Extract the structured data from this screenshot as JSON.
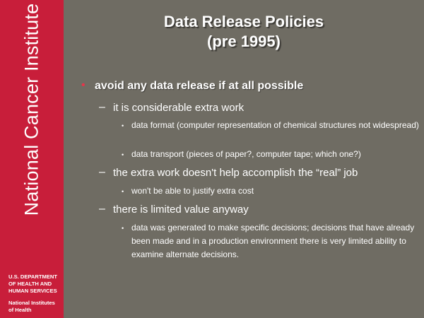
{
  "sidebar": {
    "title": "National Cancer Institute",
    "dept": [
      "U.S. DEPARTMENT",
      "OF HEALTH AND",
      "HUMAN SERVICES"
    ],
    "nih": [
      "National Institutes",
      "of Health"
    ],
    "color": "#c81e3a"
  },
  "slide": {
    "title_line1": "Data Release Policies",
    "title_line2": "(pre 1995)",
    "background": "#6f6c63"
  },
  "bullets": {
    "main": "avoid any data release if at all possible",
    "sub1": {
      "text": "it is considerable extra work",
      "items": [
        "data format (computer representation of chemical structures not widespread)",
        "data transport (pieces of paper?, computer tape; which one?)"
      ]
    },
    "sub2": {
      "text": "the extra work doesn't help accomplish the “real” job",
      "items": [
        "won't be able to justify extra cost"
      ]
    },
    "sub3": {
      "text": "there is limited value anyway",
      "items": [
        "data was generated to make specific decisions; decisions that have already been made and in a production environment there is very limited ability to examine alternate decisions."
      ]
    }
  }
}
